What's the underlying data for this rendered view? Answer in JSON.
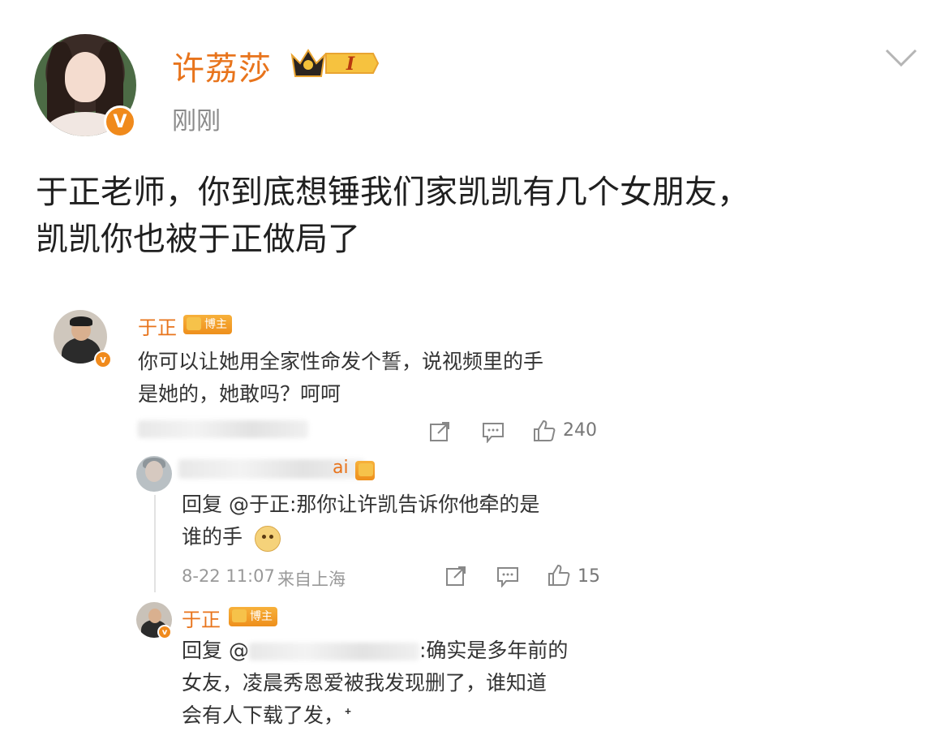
{
  "post": {
    "author": "许荔莎",
    "level_badge": "I",
    "timestamp": "刚刚",
    "verified_mark": "V",
    "text_lines": [
      "于正老师，你到底想锤我们家凯凯有几个女朋友，",
      "凯凯你也被于正做局了"
    ]
  },
  "screenshot": {
    "comment": {
      "author": "于正",
      "badge": "博主",
      "text_lines": [
        "你可以让她用全家性命发个誓，说视频里的手",
        "是她的，她敢吗？呵呵"
      ],
      "likes": "240"
    },
    "reply1": {
      "author": "ai",
      "text_lines": [
        "回复 @于正:那你让许凯告诉你他牵的是",
        "谁的手"
      ],
      "date": "8-22 11:07",
      "location": "来自上海",
      "likes": "15"
    },
    "reply2": {
      "author": "于正",
      "badge": "博主",
      "text_lines": [
        "回复 @",
        ":确实是多年前的",
        "女友，凌晨秀恩爱被我发现删了，谁知道",
        "会有人下载了发，ᐩ"
      ]
    }
  },
  "icons": [
    "chevron-down-icon",
    "crown-icon",
    "share-icon",
    "comment-icon",
    "like-icon"
  ],
  "colors": {
    "accent": "#e8741c",
    "verified": "#f08a1c"
  }
}
